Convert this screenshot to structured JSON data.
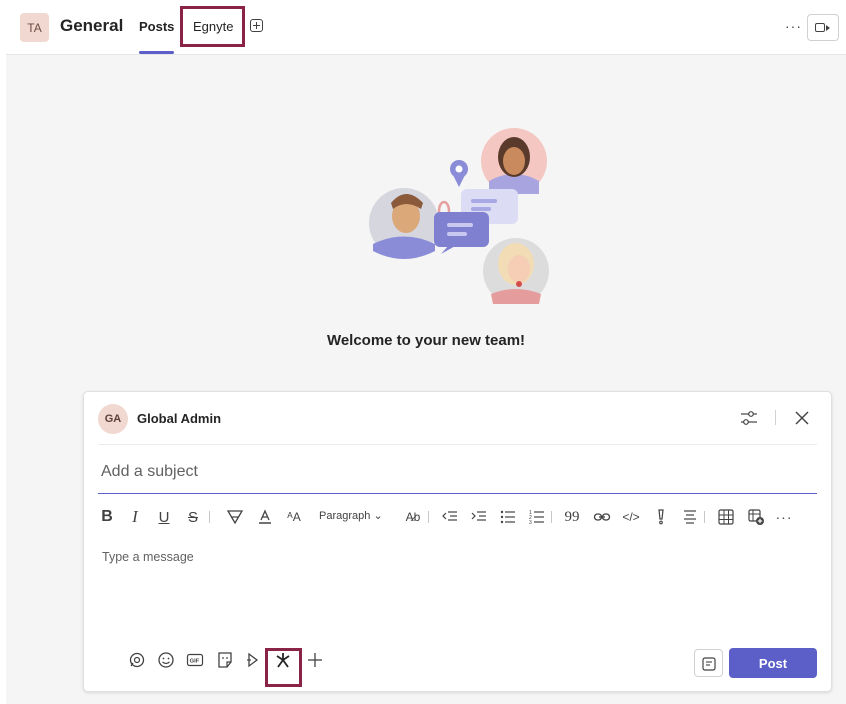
{
  "header": {
    "team_avatar": "TA",
    "channel_title": "General",
    "tabs": [
      {
        "label": "Posts",
        "active": true
      },
      {
        "label": "Egnyte",
        "active": false
      }
    ],
    "more_icon": "more-horizontal-icon",
    "video_icon": "video-camera-icon",
    "accent_color": "#5b5fc7"
  },
  "main": {
    "welcome_text": "Welcome to your new team!"
  },
  "compose": {
    "author_initials": "GA",
    "author_name": "Global Admin",
    "subject_placeholder": "Add a subject",
    "paragraph_style": "Paragraph",
    "message_placeholder": "Type a message",
    "post_label": "Post",
    "toolbar_icons": [
      "bold-icon",
      "italic-icon",
      "underline-icon",
      "strikethrough-icon",
      "highlight-icon",
      "font-color-icon",
      "font-size-icon",
      "paragraph-dropdown",
      "clear-formatting-icon",
      "decrease-indent-icon",
      "increase-indent-icon",
      "bulleted-list-icon",
      "numbered-list-icon",
      "quote-icon",
      "link-icon",
      "code-snippet-icon",
      "mark-important-icon",
      "align-icon",
      "insert-table-icon",
      "add-table-row-icon",
      "more-options-icon"
    ],
    "bottom_icons": [
      "loop-icon",
      "emoji-icon",
      "gif-icon",
      "sticker-icon",
      "schedule-meeting-icon",
      "egnyte-app-icon",
      "add-icon"
    ],
    "highlight_color": "#8b2346"
  }
}
